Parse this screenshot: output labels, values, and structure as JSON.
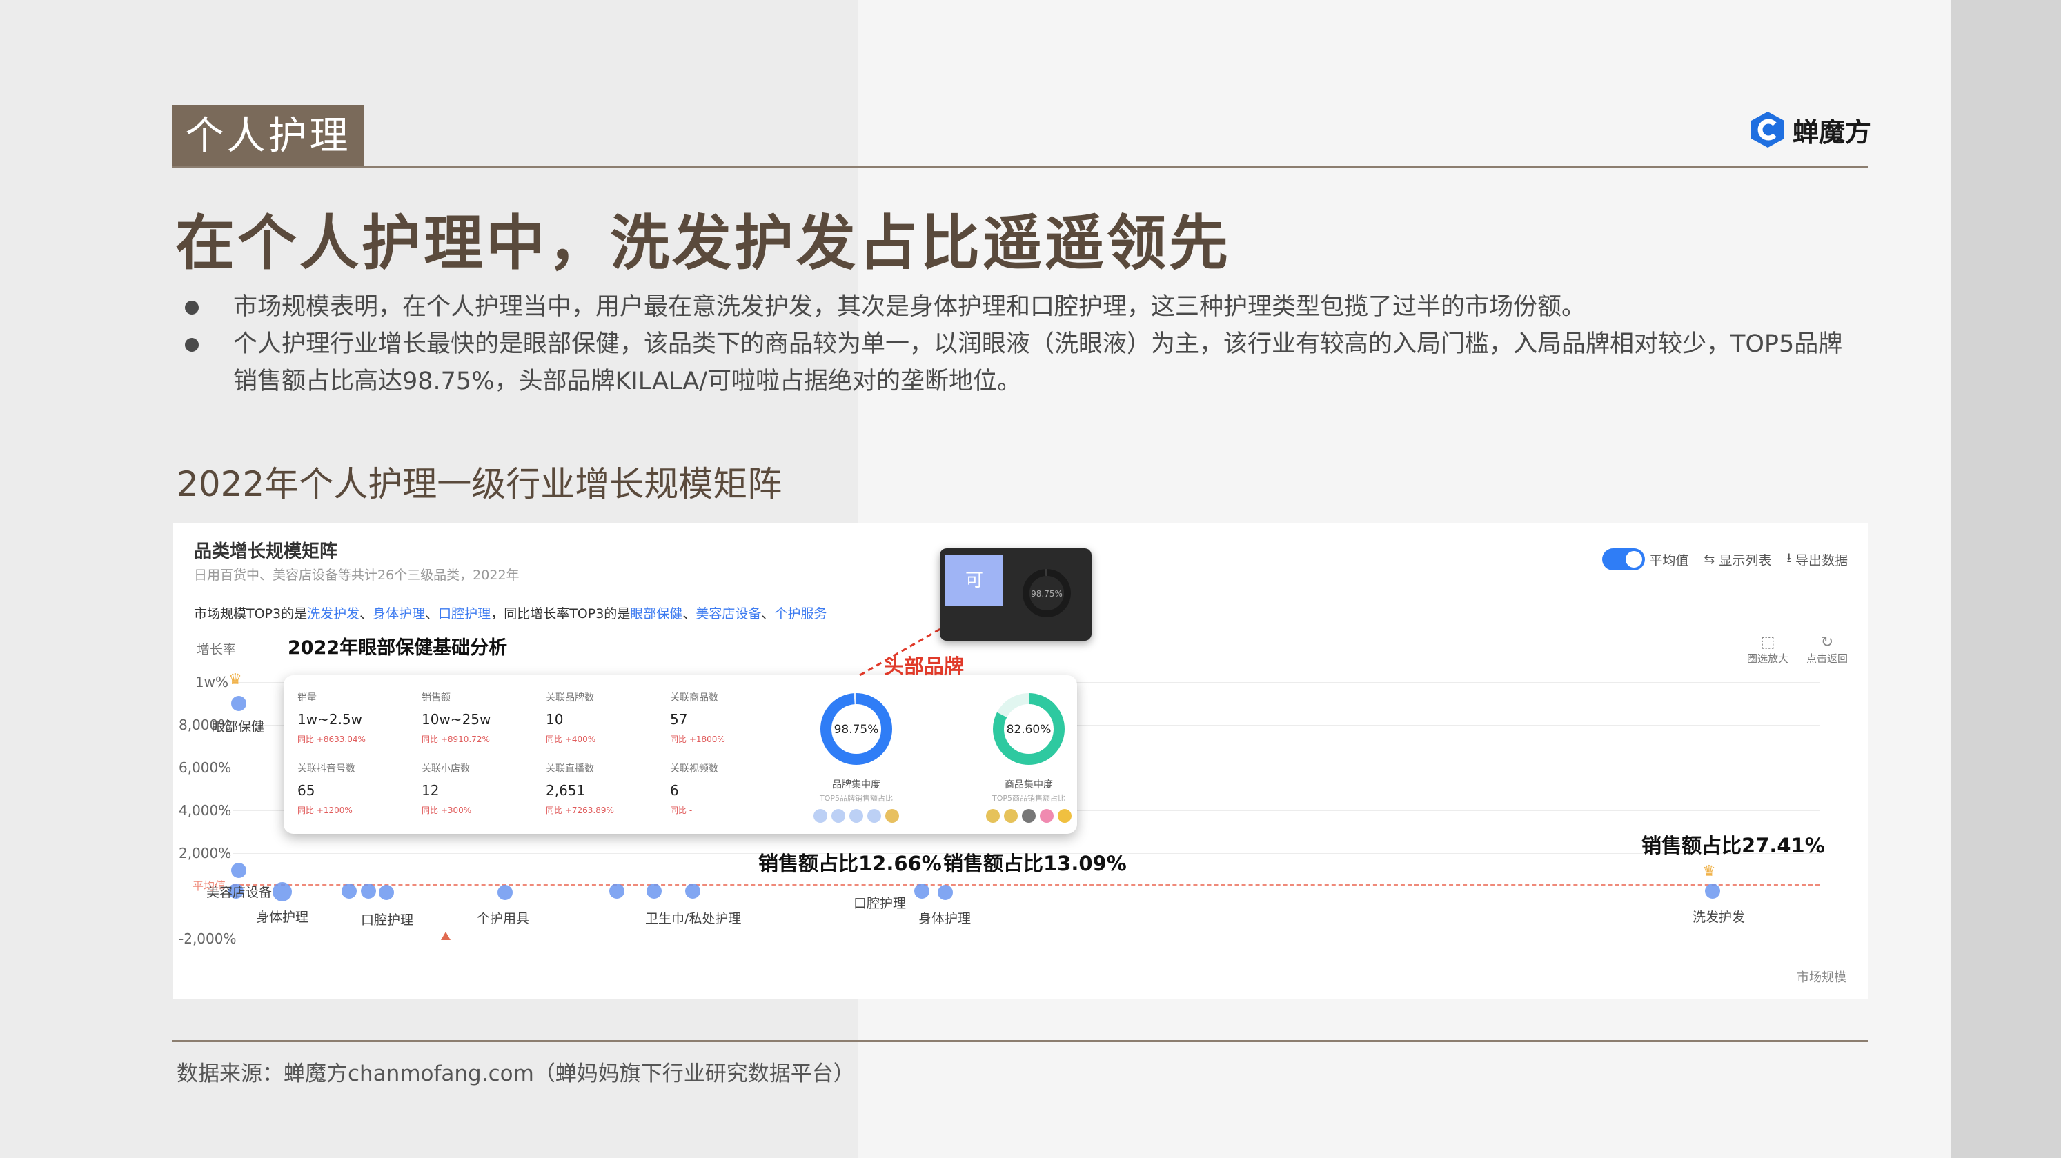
{
  "header": {
    "section_tag": "个人护理",
    "logo_text": "蝉魔方",
    "headline": "在个人护理中，洗发护发占比遥遥领先"
  },
  "bullets": [
    "市场规模表明，在个人护理当中，用户最在意洗发护发，其次是身体护理和口腔护理，这三种护理类型包揽了过半的市场份额。",
    "个人护理行业增长最快的是眼部保健，该品类下的商品较为单一，以润眼液（洗眼液）为主，该行业有较高的入局门槛，入局品牌相对较少，TOP5品牌销售额占比高达98.75%，头部品牌KILALA/可啦啦占据绝对的垄断地位。"
  ],
  "subheading": "2022年个人护理一级行业增长规模矩阵",
  "panel": {
    "title": "品类增长规模矩阵",
    "subtitle": "日用百货中、美容店设备等共计26个三级品类，2022年",
    "summary": {
      "prefix": "市场规模TOP3的是",
      "top_size": [
        "洗发护发",
        "身体护理",
        "口腔护理"
      ],
      "middle": "，同比增长率TOP3的是",
      "top_growth": [
        "眼部保健",
        "美容店设备",
        "个护服务"
      ]
    },
    "controls": {
      "avg_toggle": "平均值",
      "show_list": "显示列表",
      "export": "导出数据"
    },
    "tools": {
      "zoom": "圈选放大",
      "reset": "点击返回"
    }
  },
  "chart_data": {
    "type": "scatter",
    "title": "品类增长规模矩阵",
    "ylabel": "增长率",
    "xlabel": "市场规模",
    "y_ticks": [
      "1w%",
      "8,000%",
      "6,000%",
      "4,000%",
      "2,000%",
      "0%",
      "-2,000%"
    ],
    "avg_label": "平均值",
    "points_labeled": [
      "眼部保健",
      "美容店设备",
      "身体护理",
      "口腔护理",
      "个护用具",
      "卫生巾/私处护理",
      "口腔护理",
      "身体护理",
      "洗发护发"
    ]
  },
  "card": {
    "title": "2022年眼部保健基础分析",
    "metrics": [
      {
        "label": "销量",
        "value": "1w~2.5w",
        "change": "同比 +8633.04%"
      },
      {
        "label": "销售额",
        "value": "10w~25w",
        "change": "同比 +8910.72%"
      },
      {
        "label": "关联品牌数",
        "value": "10",
        "change": "同比 +400%"
      },
      {
        "label": "关联商品数",
        "value": "57",
        "change": "同比 +1800%"
      },
      {
        "label": "关联抖音号数",
        "value": "65",
        "change": "同比 +1200%"
      },
      {
        "label": "关联小店数",
        "value": "12",
        "change": "同比 +300%"
      },
      {
        "label": "关联直播数",
        "value": "2,651",
        "change": "同比 +7263.89%"
      },
      {
        "label": "关联视频数",
        "value": "6",
        "change": "同比 -"
      }
    ],
    "donuts": [
      {
        "value_text": "98.75%",
        "value": 98.75,
        "caption": "品牌集中度",
        "sub": "TOP5品牌销售额占比",
        "color": "#2f7df6"
      },
      {
        "value_text": "82.60%",
        "value": 82.6,
        "caption": "商品集中度",
        "sub": "TOP5商品销售额占比",
        "color": "#2ec9a0"
      }
    ]
  },
  "annotations": {
    "head_brand": "头部品牌",
    "share_a": "销售额占比12.66%",
    "share_b": "销售额占比13.09%",
    "share_c": "销售额占比27.41%"
  },
  "popup": {
    "thumb": "可",
    "pct": "98.75%"
  },
  "footer": {
    "source": "数据来源：蝉魔方chanmofang.com（蝉妈妈旗下行业研究数据平台）"
  },
  "colors": {
    "accent_brown": "#7a6a5a",
    "chart_blue": "#2f7df6",
    "chart_green": "#2ec9a0",
    "annot_red": "#e03a2a"
  }
}
